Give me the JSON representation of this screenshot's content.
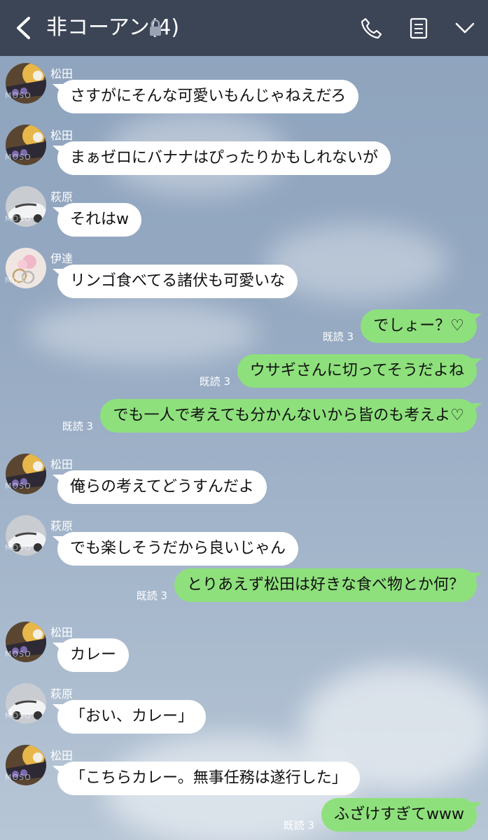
{
  "header": {
    "title": "非コーアン(4)",
    "icons": [
      "back-chevron-icon",
      "lock-icon",
      "phone-icon",
      "notes-icon",
      "chevron-down-icon"
    ]
  },
  "messages": [
    {
      "from": "in",
      "avatar": "matsuda",
      "name": "松田",
      "text": "さすがにそんな可愛いもんじゃねえだろ"
    },
    {
      "from": "in",
      "avatar": "matsuda",
      "name": "松田",
      "text": "まぁゼロにバナナはぴったりかもしれないが"
    },
    {
      "from": "in",
      "avatar": "hagiwara",
      "name": "萩原",
      "text": "それはw"
    },
    {
      "from": "in",
      "avatar": "date",
      "name": "伊達",
      "text": "リンゴ食べてる諸伏も可愛いな"
    },
    {
      "from": "out",
      "text": "でしょー？♡",
      "read": "既読 3"
    },
    {
      "from": "out",
      "text": "ウサギさんに切ってそうだよね",
      "read": "既読 3"
    },
    {
      "from": "out",
      "text": "でも一人で考えても分かんないから皆のも考えよ♡",
      "read": "既読 3"
    },
    {
      "from": "in",
      "avatar": "matsuda",
      "name": "松田",
      "text": "俺らの考えてどうすんだよ"
    },
    {
      "from": "in",
      "avatar": "hagiwara",
      "name": "萩原",
      "text": "でも楽しそうだから良いじゃん"
    },
    {
      "from": "out",
      "text": "とりあえず松田は好きな食べ物とか何？",
      "read": "既読 3"
    },
    {
      "from": "in",
      "avatar": "matsuda",
      "name": "松田",
      "text": "カレー"
    },
    {
      "from": "in",
      "avatar": "hagiwara",
      "name": "萩原",
      "text": "「おい、カレー」"
    },
    {
      "from": "in",
      "avatar": "matsuda",
      "name": "松田",
      "text": "「こちらカレー。無事任務は遂行した」"
    },
    {
      "from": "out",
      "text": "ふざけすぎてwww",
      "read": "既読 3"
    }
  ],
  "avatar_watermark": "MOSO",
  "colors": {
    "header_bg": "#3b4556",
    "outgoing_bubble": "#8ee07c",
    "incoming_bubble": "#ffffff"
  }
}
